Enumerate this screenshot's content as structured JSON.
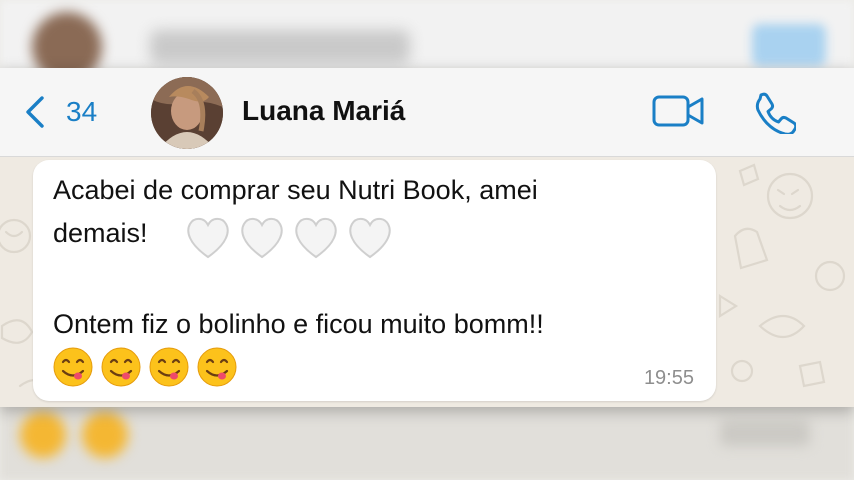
{
  "header": {
    "back_count": "34",
    "contact_name": "Luana Mariá"
  },
  "message": {
    "line1": "Acabei de comprar seu Nutri Book, amei",
    "line2": "demais!",
    "line3": "Ontem fiz o bolinho e ficou muito bomm!!",
    "time": "19:55",
    "hearts": [
      "white-heart-emoji",
      "white-heart-emoji",
      "white-heart-emoji",
      "white-heart-emoji"
    ],
    "faces": [
      "yum-face-emoji",
      "yum-face-emoji",
      "yum-face-emoji",
      "yum-face-emoji"
    ]
  },
  "colors": {
    "accent": "#1a7fc6",
    "bubble": "#ffffff",
    "chat_bg": "#efeae2",
    "header_bg": "#f6f6f6"
  }
}
